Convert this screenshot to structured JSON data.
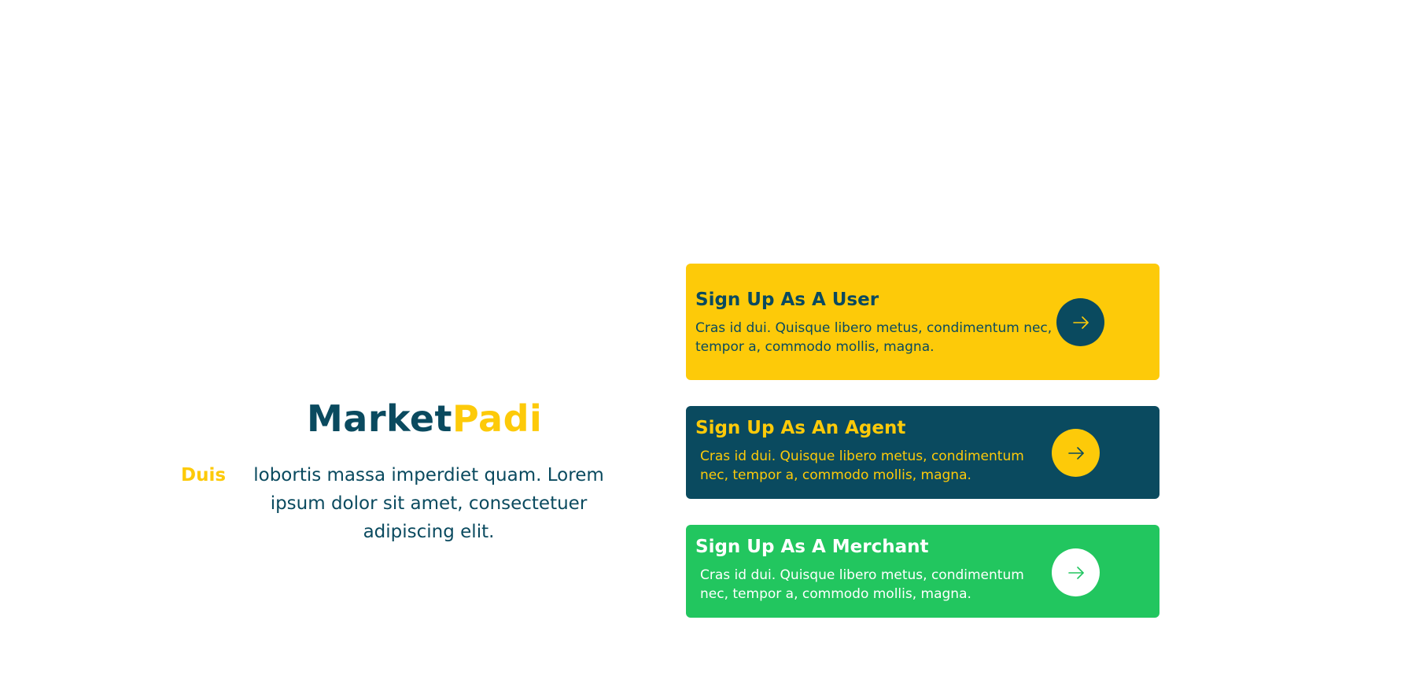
{
  "brand": {
    "name_part1": "Market",
    "name_part2": "Padi"
  },
  "tagline": {
    "highlight": "Duis",
    "text": "lobortis massa imperdiet quam. Lorem ipsum dolor sit amet, consectetuer adipiscing elit."
  },
  "cards": [
    {
      "title": "Sign Up As A User",
      "description": "Cras id dui. Quisque libero metus, condimentum nec, tempor a, commodo mollis, magna.",
      "icon": "arrow-right-icon",
      "background": "#fdca09"
    },
    {
      "title": "Sign Up As An Agent",
      "description": "Cras id dui. Quisque libero metus, condimentum nec, tempor a, commodo mollis, magna.",
      "icon": "arrow-right-icon",
      "background": "#0a4a5f"
    },
    {
      "title": "Sign Up As A Merchant",
      "description": "Cras id dui. Quisque libero metus, condimentum nec, tempor a, commodo mollis, magna.",
      "icon": "arrow-right-icon",
      "background": "#22c65f"
    }
  ],
  "colors": {
    "navy": "#0a4a5f",
    "yellow": "#fdca09",
    "green": "#22c65f",
    "white": "#ffffff"
  }
}
